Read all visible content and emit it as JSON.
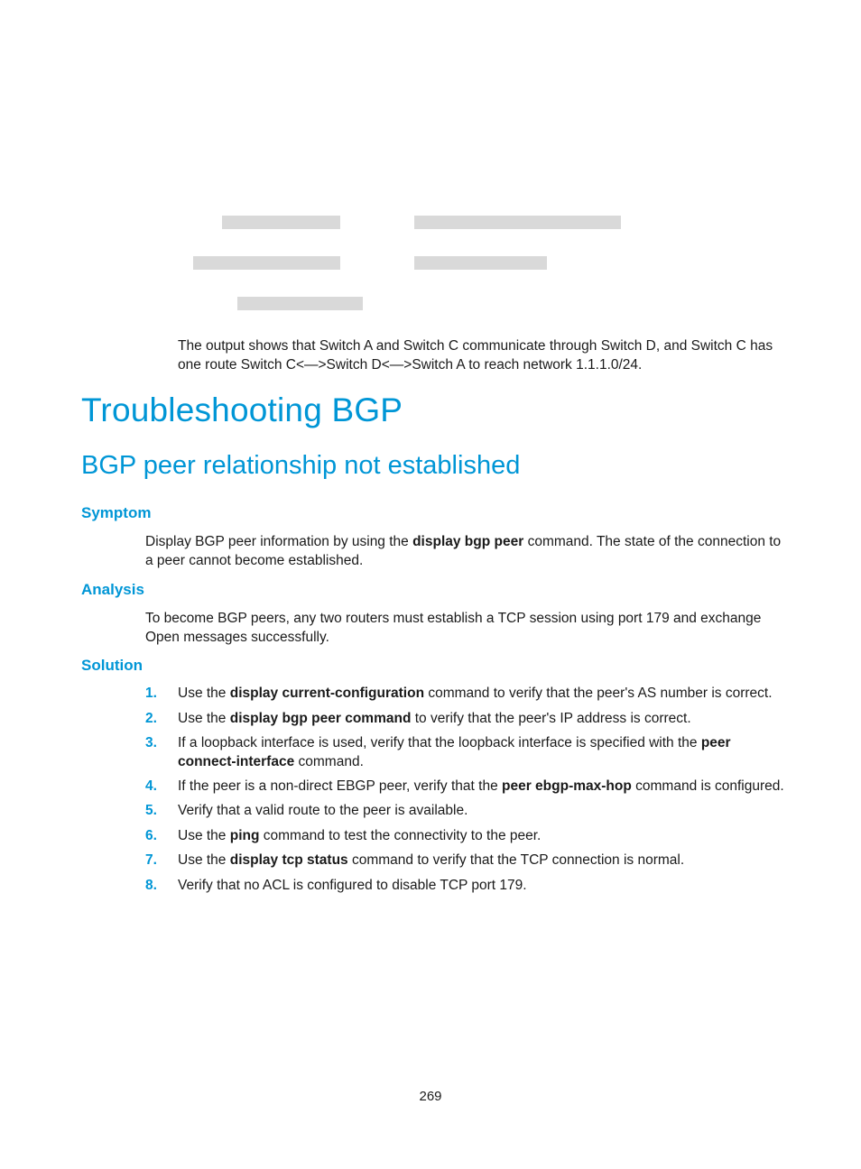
{
  "intro": {
    "text": "The output shows that Switch A and Switch C communicate through Switch D, and Switch C has one route Switch C<—>Switch D<—>Switch A to reach network 1.1.1.0/24."
  },
  "title": "Troubleshooting BGP",
  "section": {
    "title": "BGP peer relationship not established",
    "symptom": {
      "heading": "Symptom",
      "pre": "Display BGP peer information by using the ",
      "bold": "display bgp peer",
      "post": " command. The state of the connection to a peer cannot become established."
    },
    "analysis": {
      "heading": "Analysis",
      "text": "To become BGP peers, any two routers must establish a TCP session using port 179 and exchange Open messages successfully."
    },
    "solution": {
      "heading": "Solution",
      "steps": [
        {
          "num": "1.",
          "pre": "Use the ",
          "bold": "display current-configuration",
          "post": " command to verify that the peer's AS number is correct."
        },
        {
          "num": "2.",
          "pre": "Use the ",
          "bold": "display bgp peer command",
          "post": " to verify that the peer's IP address is correct."
        },
        {
          "num": "3.",
          "pre": "If a loopback interface is used, verify that the loopback interface is specified with the ",
          "bold": "peer connect-interface",
          "post": " command."
        },
        {
          "num": "4.",
          "pre": "If the peer is a non-direct EBGP peer, verify that the ",
          "bold": "peer ebgp-max-hop",
          "post": " command is configured."
        },
        {
          "num": "5.",
          "pre": "Verify that a valid route to the peer is available.",
          "bold": "",
          "post": ""
        },
        {
          "num": "6.",
          "pre": "Use the ",
          "bold": "ping",
          "post": " command to test the connectivity to the peer."
        },
        {
          "num": "7.",
          "pre": "Use the ",
          "bold": "display tcp status",
          "post": " command to verify that the TCP connection is normal."
        },
        {
          "num": "8.",
          "pre": "Verify that no ACL is configured to disable TCP port 179.",
          "bold": "",
          "post": ""
        }
      ]
    }
  },
  "page_number": "269"
}
